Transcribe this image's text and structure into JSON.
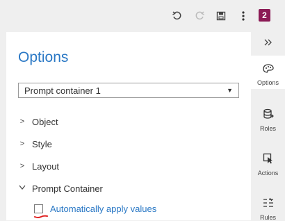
{
  "toolbar": {
    "badge_count": "2",
    "icons": [
      "undo-icon",
      "redo-icon",
      "save-icon",
      "more-vertical-icon"
    ]
  },
  "panel": {
    "title": "Options",
    "select": {
      "value": "Prompt container 1"
    },
    "sections": [
      {
        "label": "Object",
        "expanded": false
      },
      {
        "label": "Style",
        "expanded": false
      },
      {
        "label": "Layout",
        "expanded": false
      },
      {
        "label": "Prompt Container",
        "expanded": true
      }
    ],
    "auto_apply": {
      "label": "Automatically apply values",
      "checked": false
    }
  },
  "rail": {
    "items": [
      {
        "label": "Options",
        "icon": "palette-icon",
        "active": true
      },
      {
        "label": "Roles",
        "icon": "database-icon"
      },
      {
        "label": "Actions",
        "icon": "cursor-icon"
      },
      {
        "label": "Rules",
        "icon": "rules-icon"
      }
    ]
  },
  "colors": {
    "accent": "#2a78c5",
    "badge": "#8b1a55",
    "annotation": "#e02020"
  }
}
